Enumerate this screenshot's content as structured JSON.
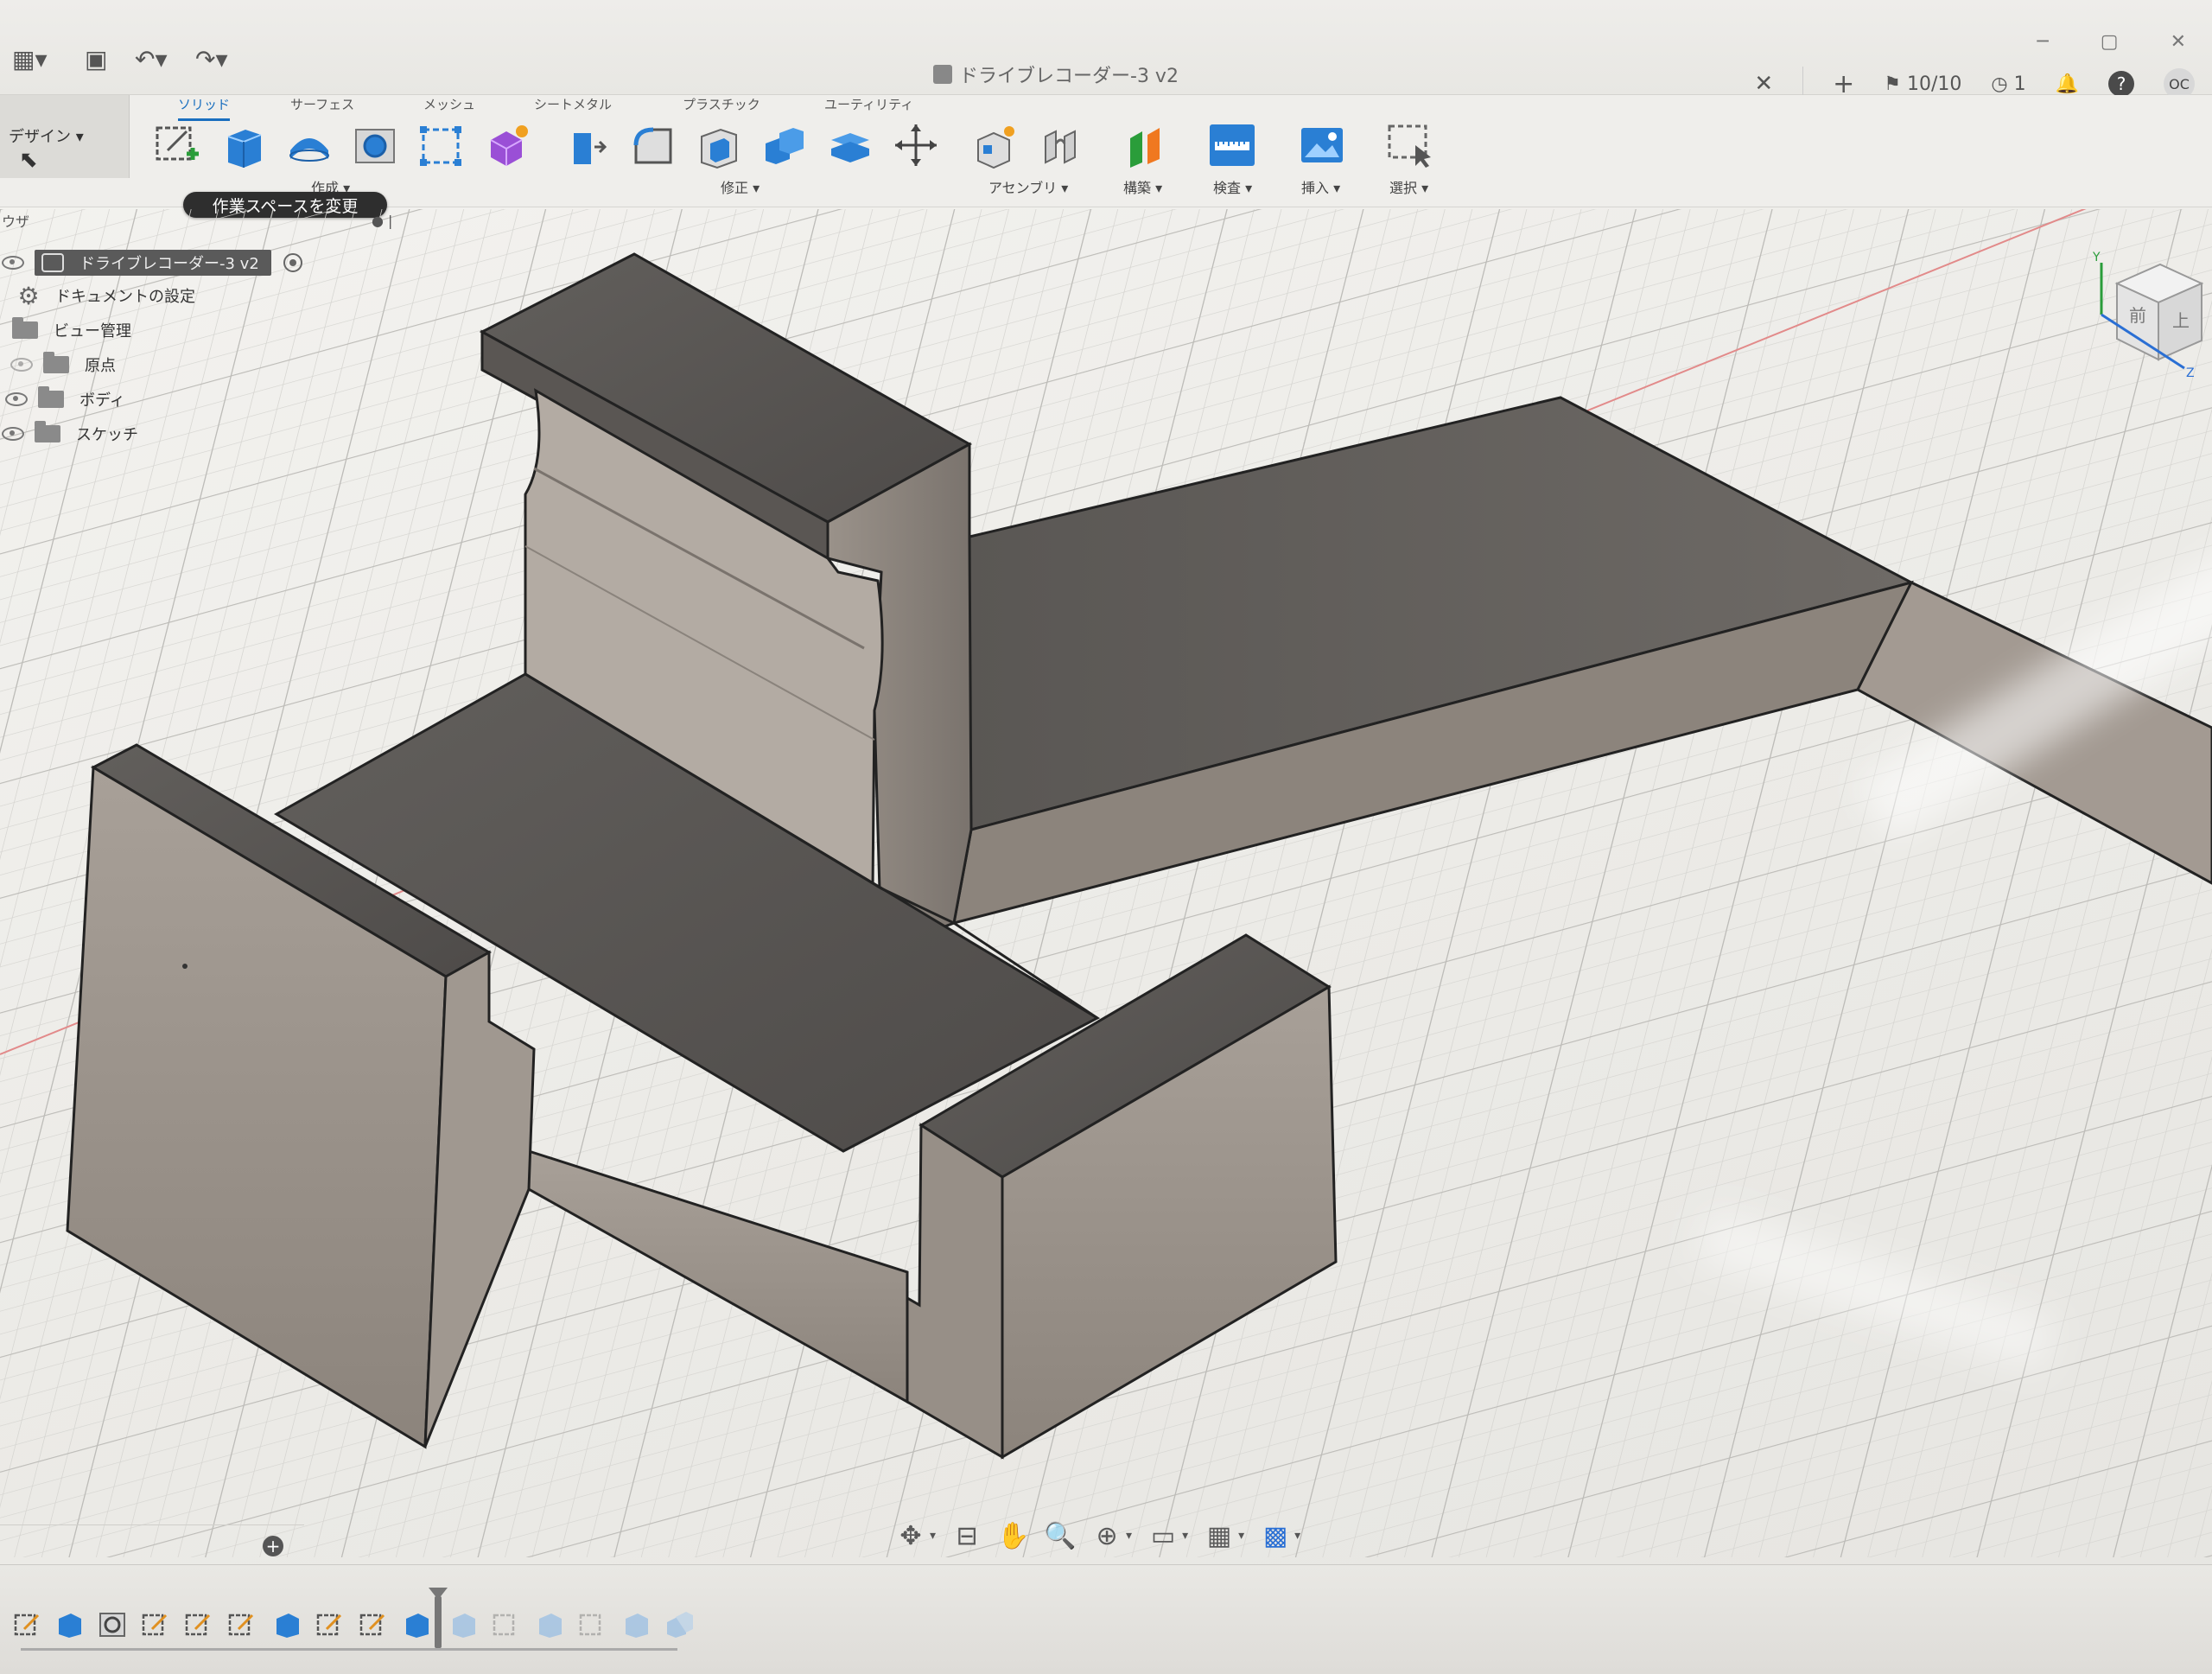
{
  "app": {
    "document_title": "ドライブレコーダー-3 v2",
    "workspace": "デザイン",
    "tooltip": "作業スペースを変更",
    "job_status": "10/10",
    "notification_count": "1",
    "user_initials": "OC"
  },
  "ribbon": {
    "tabs": [
      "ソリッド",
      "サーフェス",
      "メッシュ",
      "シートメタル",
      "プラスチック",
      "ユーティリティ"
    ],
    "groups": {
      "create": "作成",
      "modify": "修正",
      "assemble": "アセンブリ",
      "construct": "構築",
      "inspect": "検査",
      "insert": "挿入",
      "select": "選択"
    }
  },
  "browser": {
    "header": "ウザ",
    "root": "ドライブレコーダー-3 v2",
    "items": [
      "ドキュメントの設定",
      "ビュー管理",
      "原点",
      "ボディ",
      "スケッチ"
    ]
  },
  "viewcube": {
    "faces": [
      "前",
      "上"
    ],
    "axes": [
      "Y",
      "Z"
    ]
  },
  "colors": {
    "accent": "#1a6fbf",
    "model_top": "#5e5b58",
    "model_side": "#8e867f",
    "model_front": "#a39a92",
    "grid": "#cfcfcf"
  },
  "icons": {
    "navbar": [
      "orbit-icon",
      "look-at-icon",
      "pan-icon",
      "zoom-icon",
      "fit-icon",
      "display-settings-icon",
      "grid-icon",
      "viewports-icon"
    ]
  }
}
